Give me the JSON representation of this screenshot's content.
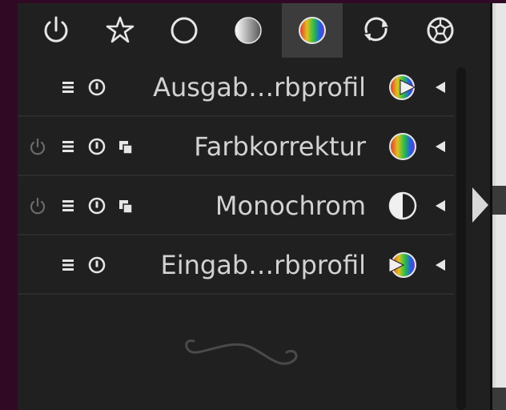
{
  "toolbar": {
    "groups": [
      {
        "icon": "power-icon"
      },
      {
        "icon": "star-icon"
      },
      {
        "icon": "circle-outline-icon"
      },
      {
        "icon": "gradient-circle-icon"
      },
      {
        "icon": "color-circle-icon",
        "active": true
      },
      {
        "icon": "rotate-icon"
      },
      {
        "icon": "soccer-ball-icon"
      }
    ]
  },
  "modules": [
    {
      "label": "Ausgab…rbprofil",
      "icon": "output-color-profile-icon",
      "has_power": false,
      "has_multi": false
    },
    {
      "label": "Farbkorrektur",
      "icon": "color-correction-icon",
      "has_power": true,
      "has_multi": true
    },
    {
      "label": "Monochrom",
      "icon": "monochrome-icon",
      "has_power": true,
      "has_multi": true
    },
    {
      "label": "Eingab…rbprofil",
      "icon": "input-color-profile-icon",
      "has_power": false,
      "has_multi": false
    }
  ],
  "colors": {
    "panel_bg": "#202020",
    "active_tab_bg": "#3c3c3c",
    "text": "#d2d2d2",
    "icon": "#e6e6e6",
    "dim_icon": "#6a6a6a",
    "desktop_bg": "#300a24"
  }
}
